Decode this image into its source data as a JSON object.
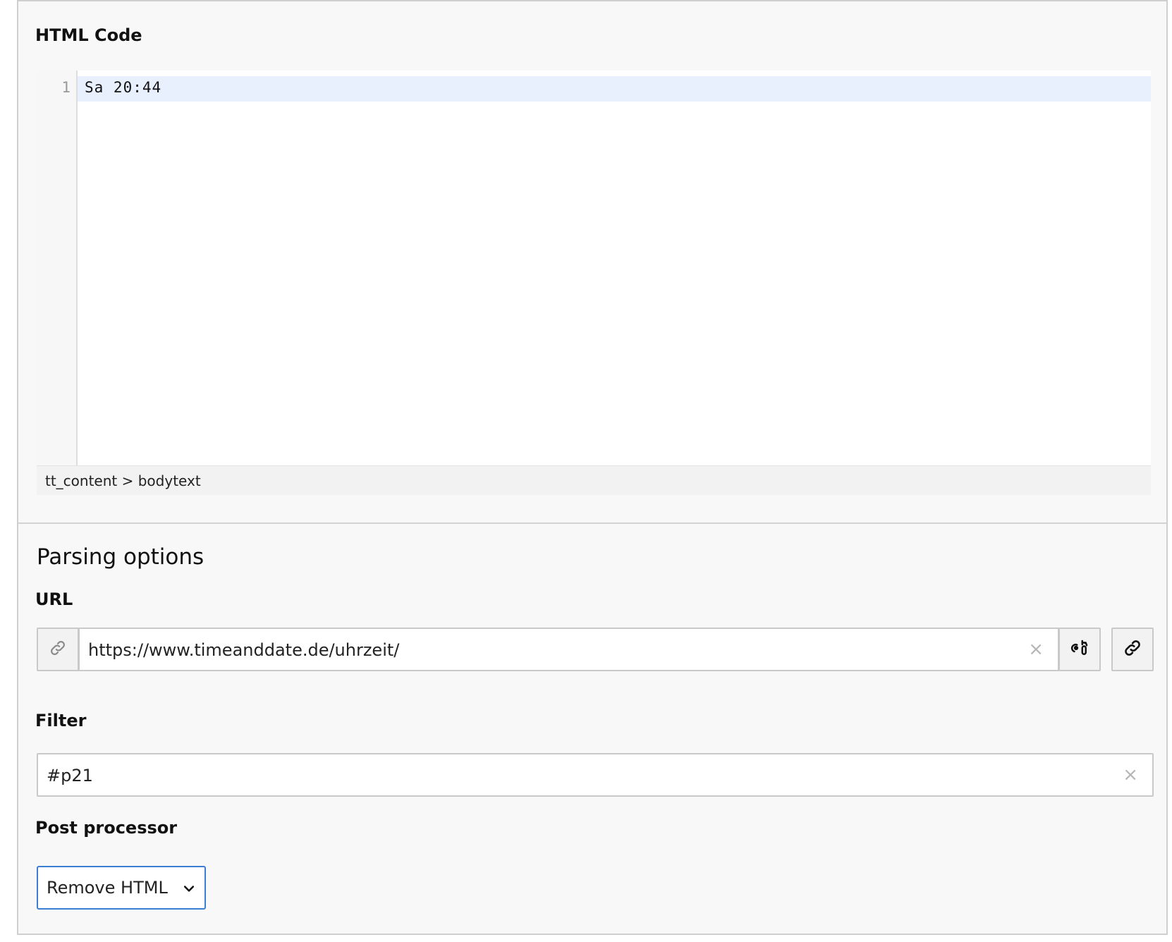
{
  "html_code": {
    "label": "HTML Code",
    "editor": {
      "line_number": "1",
      "code": "Sa 20:44"
    },
    "status_path": "tt_content > bodytext"
  },
  "parsing_options": {
    "heading": "Parsing options",
    "url": {
      "label": "URL",
      "value": "https://www.timeanddate.de/uhrzeit/",
      "clear_symbol": "×"
    },
    "filter": {
      "label": "Filter",
      "value": "#p21",
      "clear_symbol": "×"
    },
    "post_processor": {
      "label": "Post processor",
      "selected": "Remove HTML"
    }
  },
  "icons": {
    "url_addon": "link-icon",
    "unlink_button": "unlink-icon",
    "link_browser_button": "link-icon"
  }
}
